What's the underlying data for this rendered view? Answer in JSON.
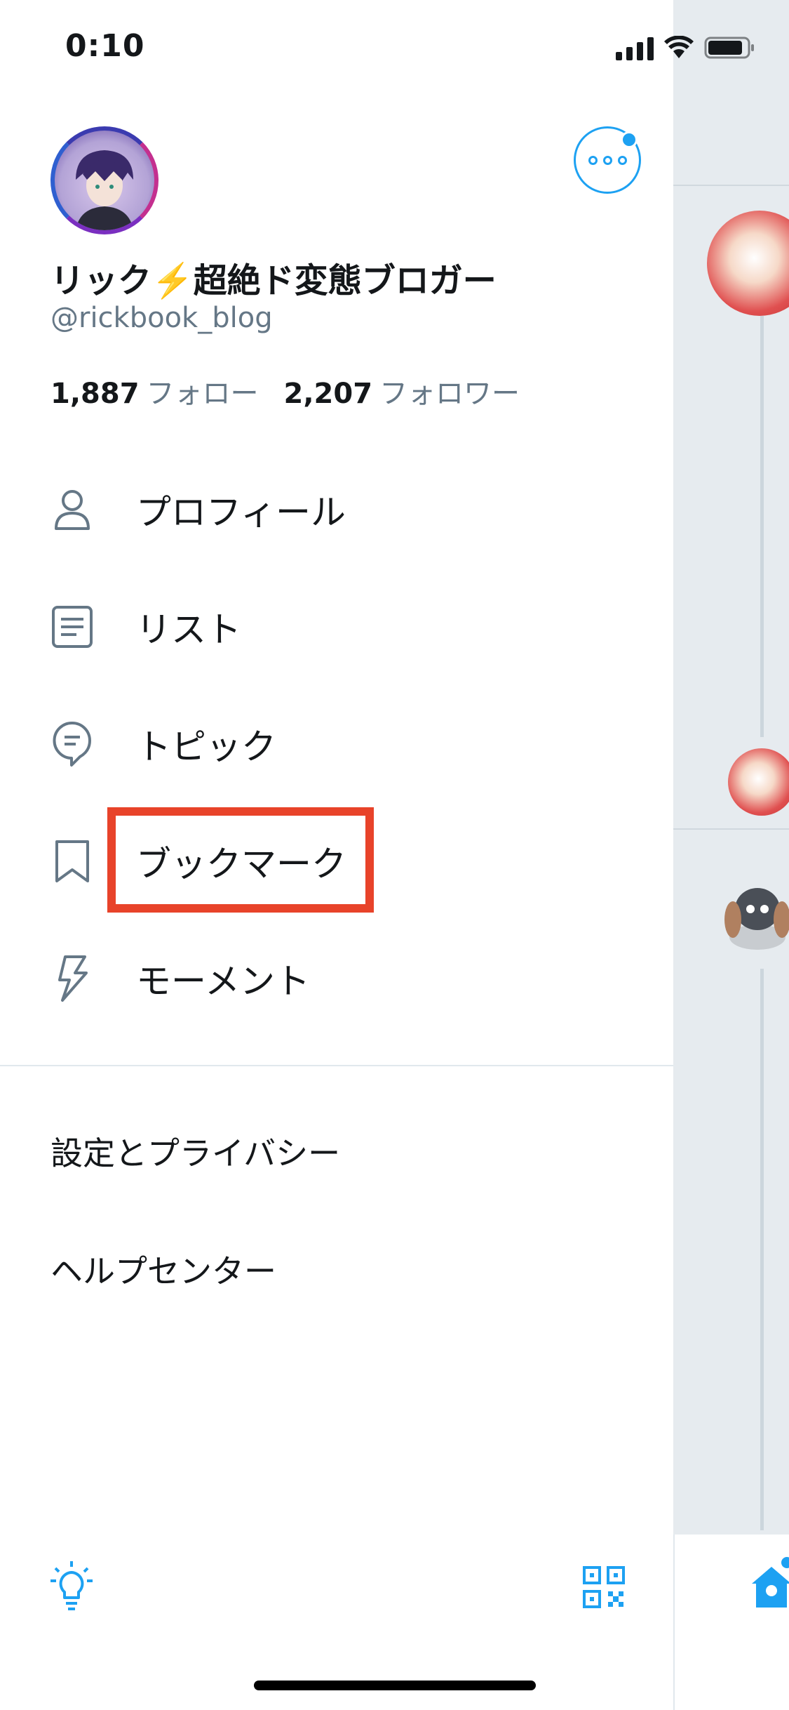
{
  "status_bar": {
    "time": "0:10"
  },
  "profile": {
    "display_name": "リック⚡️超絶ド変態ブロガー",
    "handle": "@rickbook_blog",
    "following_count": "1,887",
    "following_label": "フォロー",
    "followers_count": "2,207",
    "followers_label": "フォロワー"
  },
  "menu": {
    "items": [
      {
        "label": "プロフィール",
        "icon": "person-icon"
      },
      {
        "label": "リスト",
        "icon": "list-icon"
      },
      {
        "label": "トピック",
        "icon": "topic-bubble-icon"
      },
      {
        "label": "ブックマーク",
        "icon": "bookmark-icon"
      },
      {
        "label": "モーメント",
        "icon": "lightning-icon"
      }
    ],
    "secondary": [
      {
        "label": "設定とプライバシー"
      },
      {
        "label": "ヘルプセンター"
      }
    ]
  },
  "footer": {
    "left_icon": "lightbulb-icon",
    "right_icon": "qr-code-icon"
  },
  "colors": {
    "accent": "#1da1f2",
    "highlight": "#e8432a",
    "secondary_text": "#657786"
  }
}
